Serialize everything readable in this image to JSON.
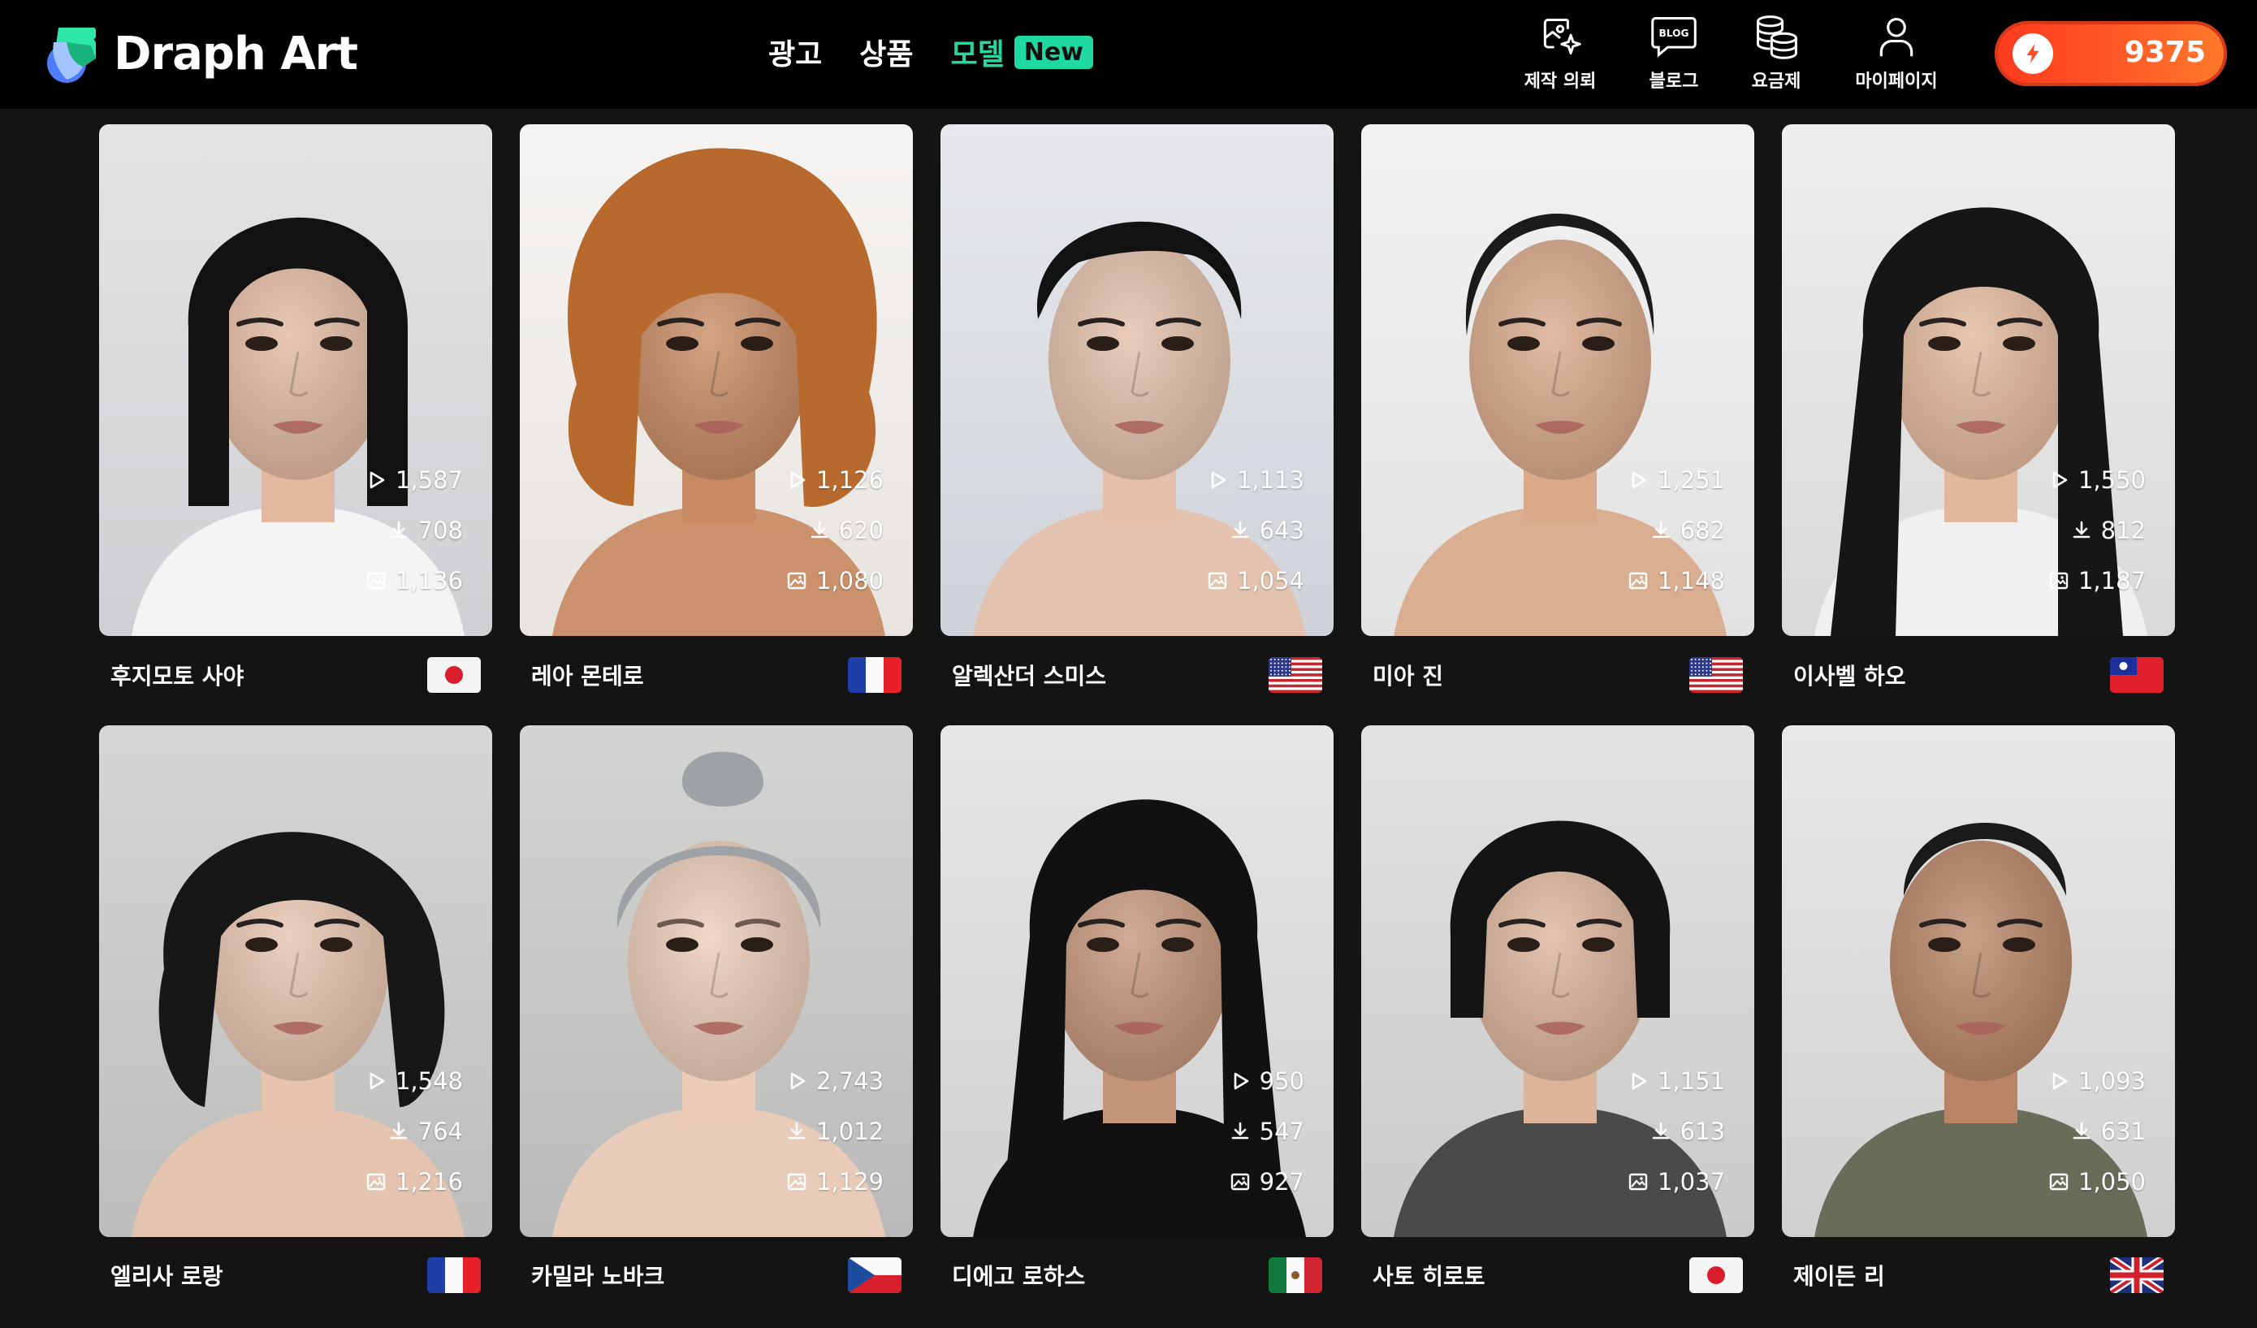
{
  "brand": {
    "name": "Draph Art"
  },
  "nav": {
    "ads": "광고",
    "products": "상품",
    "models": "모델",
    "new_badge": "New"
  },
  "utility": {
    "request": "제작 의뢰",
    "blog": "블로그",
    "blog_icon_text": "BLOG",
    "pricing": "요금제",
    "mypage": "마이페이지"
  },
  "credits": {
    "value": "9375"
  },
  "colors": {
    "accent": "#2ad6a0",
    "credit": "#ff4a22",
    "background": "#141414"
  },
  "models": [
    {
      "name": "후지모토 사야",
      "country": "japan",
      "plays": "1,587",
      "downloads": "708",
      "images": "1,136"
    },
    {
      "name": "레아 몬테로",
      "country": "france",
      "plays": "1,126",
      "downloads": "620",
      "images": "1,080"
    },
    {
      "name": "알렉산더 스미스",
      "country": "usa",
      "plays": "1,113",
      "downloads": "643",
      "images": "1,054"
    },
    {
      "name": "미아 진",
      "country": "usa",
      "plays": "1,251",
      "downloads": "682",
      "images": "1,148"
    },
    {
      "name": "이사벨 하오",
      "country": "taiwan",
      "plays": "1,550",
      "downloads": "812",
      "images": "1,187"
    },
    {
      "name": "엘리사 로랑",
      "country": "france",
      "plays": "1,548",
      "downloads": "764",
      "images": "1,216"
    },
    {
      "name": "카밀라 노바크",
      "country": "czech",
      "plays": "2,743",
      "downloads": "1,012",
      "images": "1,129"
    },
    {
      "name": "디에고 로하스",
      "country": "mexico",
      "plays": "950",
      "downloads": "547",
      "images": "927"
    },
    {
      "name": "사토 히로토",
      "country": "japan",
      "plays": "1,151",
      "downloads": "613",
      "images": "1,037"
    },
    {
      "name": "제이든 리",
      "country": "uk",
      "plays": "1,093",
      "downloads": "631",
      "images": "1,050"
    }
  ]
}
